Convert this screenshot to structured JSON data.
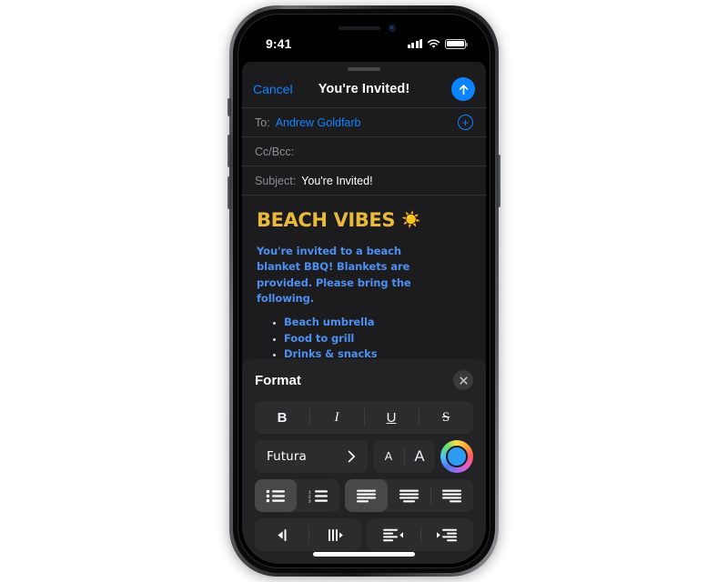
{
  "device": {
    "status_bar": {
      "time": "9:41",
      "cellular_icon": "signal-bars-icon",
      "wifi_icon": "wifi-icon",
      "battery_icon": "battery-icon"
    },
    "home_indicator": "home-indicator"
  },
  "compose": {
    "grabber": "sheet-grabber",
    "cancel_label": "Cancel",
    "title": "You're Invited!",
    "send_icon": "send-arrow-up-icon",
    "fields": [
      {
        "label": "To:",
        "value": "Andrew Goldfarb",
        "action_icon": "add-contact-icon"
      },
      {
        "label": "Cc/Bcc:",
        "value": ""
      },
      {
        "label": "Subject:",
        "value": "You're Invited!"
      }
    ]
  },
  "message": {
    "heading": "BEACH VIBES",
    "heading_emoji": "☀️",
    "heading_color": "#E9B93C",
    "body_color": "#4D8FF0",
    "paragraph": "You're invited to a beach blanket BBQ! Blankets are provided. Please bring the following.",
    "bullets": [
      "Beach umbrella",
      "Food to grill",
      "Drinks & snacks"
    ]
  },
  "format_panel": {
    "title": "Format",
    "close_icon": "close-x-icon",
    "style_buttons": [
      {
        "name": "bold-button",
        "label": "B",
        "active": false
      },
      {
        "name": "italic-button",
        "label": "I",
        "active": false
      },
      {
        "name": "underline-button",
        "label": "U",
        "active": false
      },
      {
        "name": "strikethrough-button",
        "label": "S",
        "active": false
      }
    ],
    "font": {
      "name": "Futura",
      "chevron_icon": "chevron-right-icon"
    },
    "size_buttons": [
      {
        "name": "decrease-font-size-button",
        "label": "A"
      },
      {
        "name": "increase-font-size-button",
        "label": "A"
      }
    ],
    "color_wheel": {
      "name": "text-color-wheel",
      "selected_color": "#2F9BF5"
    },
    "list_buttons": [
      {
        "name": "bulleted-list-button",
        "icon": "bulleted-list-icon",
        "active": true
      },
      {
        "name": "numbered-list-button",
        "icon": "numbered-list-icon",
        "active": false
      }
    ],
    "align_buttons": [
      {
        "name": "align-left-button",
        "icon": "align-left-icon",
        "active": true
      },
      {
        "name": "align-center-button",
        "icon": "align-center-icon",
        "active": false
      },
      {
        "name": "align-right-button",
        "icon": "align-right-icon",
        "active": false
      }
    ],
    "indent_buttons": [
      {
        "name": "tab-left-button",
        "icon": "tab-left-icon"
      },
      {
        "name": "tab-stops-button",
        "icon": "tab-stops-icon"
      },
      {
        "name": "outdent-button",
        "icon": "decrease-indent-icon"
      },
      {
        "name": "indent-button",
        "icon": "increase-indent-icon"
      }
    ]
  }
}
